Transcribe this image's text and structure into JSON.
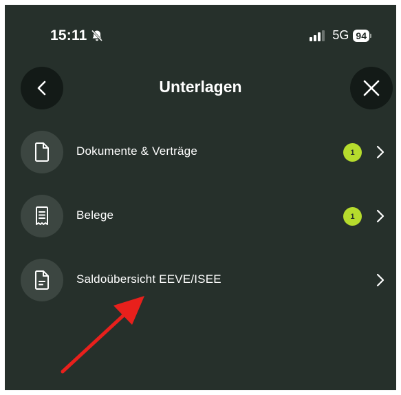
{
  "status_bar": {
    "time": "15:11",
    "network": "5G",
    "battery": "94",
    "icons": [
      "bell-slash-icon",
      "signal-bars-icon",
      "battery-icon"
    ]
  },
  "header": {
    "title": "Unterlagen",
    "back_icon": "chevron-left-icon",
    "close_icon": "close-icon"
  },
  "list": {
    "items": [
      {
        "label": "Dokumente & Verträge",
        "icon": "document-icon",
        "badge": "1"
      },
      {
        "label": "Belege",
        "icon": "receipt-icon",
        "badge": "1"
      },
      {
        "label": "Saldoübersicht EEVE/ISEE",
        "icon": "file-lines-icon",
        "badge": null
      }
    ]
  },
  "annotation": {
    "type": "red-arrow",
    "color": "#e8201c",
    "points_to": "Saldoübersicht EEVE/ISEE"
  },
  "colors": {
    "background": "#26302b",
    "button_bg": "#131a17",
    "icon_circle_bg": "#3c4641",
    "badge": "#b6dc2d",
    "text": "#ffffff"
  }
}
